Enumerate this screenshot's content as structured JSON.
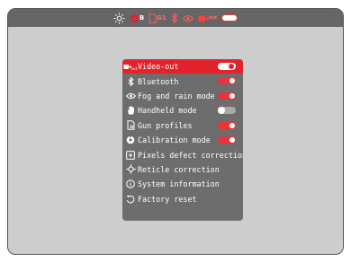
{
  "status_bar": {
    "icons": [
      "brightness-icon",
      "calibration-icon",
      "gun-profile-icon",
      "bluetooth-icon",
      "eye-icon",
      "video-out-icon",
      "battery-icon"
    ],
    "calibration_label": "B",
    "gun_profile_label": "G1",
    "video_out_sub": "out"
  },
  "menu": {
    "items": [
      {
        "label": "Video-out",
        "icon": "video-out-icon",
        "toggle": "on",
        "active": true,
        "icon_sub": "out"
      },
      {
        "label": "Bluetooth",
        "icon": "bluetooth-icon",
        "toggle": "on"
      },
      {
        "label": "Fog and rain mode",
        "icon": "eye-icon",
        "toggle": "on"
      },
      {
        "label": "Handheld mode",
        "icon": "hand-icon",
        "toggle": "off"
      },
      {
        "label": "Gun profiles",
        "icon": "gun-profile-icon",
        "toggle": "on"
      },
      {
        "label": "Calibration mode",
        "icon": "calibration-icon",
        "toggle": "on"
      },
      {
        "label": "Pixels defect correction",
        "icon": "pixel-defect-icon"
      },
      {
        "label": "Reticle correction",
        "icon": "crosshair-icon"
      },
      {
        "label": "System information",
        "icon": "info-icon"
      },
      {
        "label": "Factory reset",
        "icon": "reset-icon"
      }
    ]
  },
  "colors": {
    "accent": "#e3232b",
    "menu_bg": "#6d6d6d",
    "screen_bg": "#cdcdcd",
    "status_bg": "#666666"
  }
}
